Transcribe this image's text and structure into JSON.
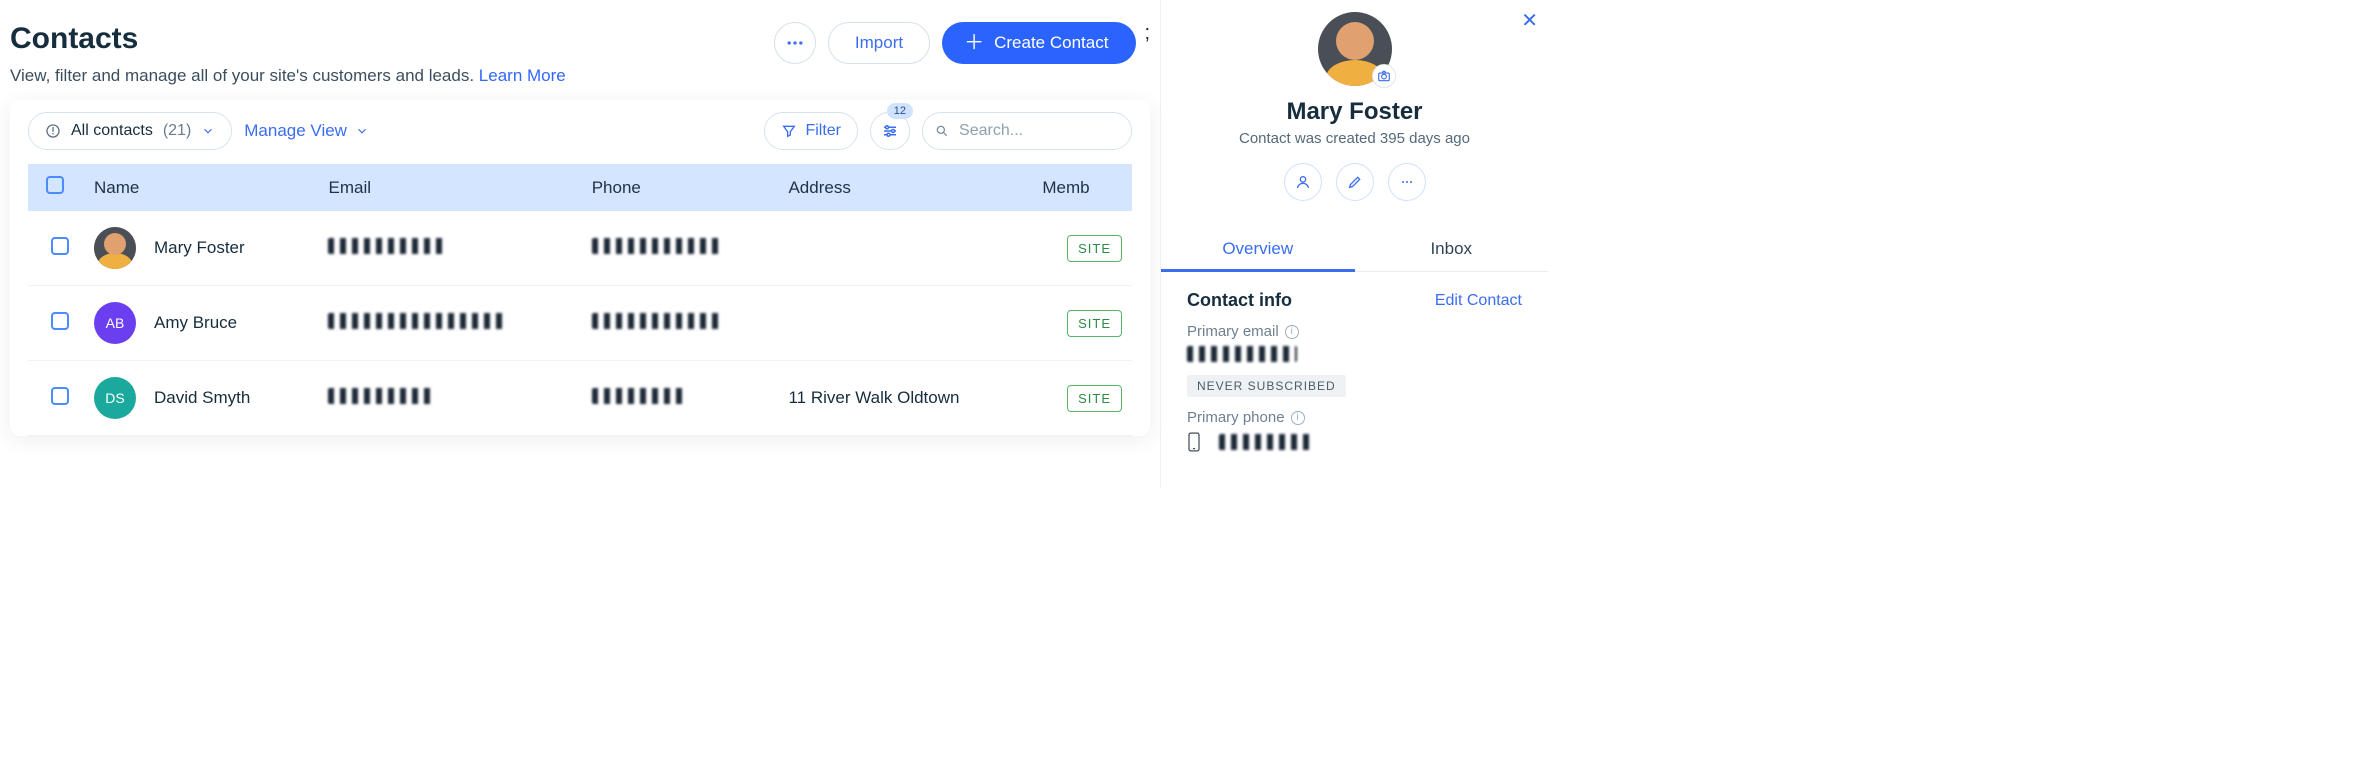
{
  "header": {
    "title": "Contacts",
    "subtitle": "View, filter and manage all of your site's customers and leads. ",
    "learn_more": "Learn More",
    "import_label": "Import",
    "create_label": "Create Contact",
    "stray_char": ";"
  },
  "toolbar": {
    "view_label": "All contacts",
    "view_count": "(21)",
    "manage_view": "Manage View",
    "filter": "Filter",
    "sliders_badge": "12",
    "search_placeholder": "Search..."
  },
  "table": {
    "columns": {
      "name": "Name",
      "email": "Email",
      "phone": "Phone",
      "address": "Address",
      "member": "Memb"
    },
    "rows": [
      {
        "name": "Mary Foster",
        "avatar_type": "photo",
        "initials": "",
        "email_w": 120,
        "phone_w": 128,
        "address": "",
        "badge": "SITE"
      },
      {
        "name": "Amy Bruce",
        "avatar_type": "ab",
        "initials": "AB",
        "email_w": 178,
        "phone_w": 128,
        "address": "",
        "badge": "SITE"
      },
      {
        "name": "David Smyth",
        "avatar_type": "ds",
        "initials": "DS",
        "email_w": 104,
        "phone_w": 92,
        "address": "11 River Walk Oldtown",
        "badge": "SITE"
      }
    ]
  },
  "side": {
    "name": "Mary Foster",
    "created": "Contact was created 395 days ago",
    "tabs": {
      "overview": "Overview",
      "inbox": "Inbox"
    },
    "contact_info_title": "Contact info",
    "edit_contact": "Edit Contact",
    "primary_email_label": "Primary email",
    "never_subscribed": "NEVER SUBSCRIBED",
    "primary_phone_label": "Primary phone",
    "email_redacted_w": 110,
    "phone_redacted_w": 92
  }
}
